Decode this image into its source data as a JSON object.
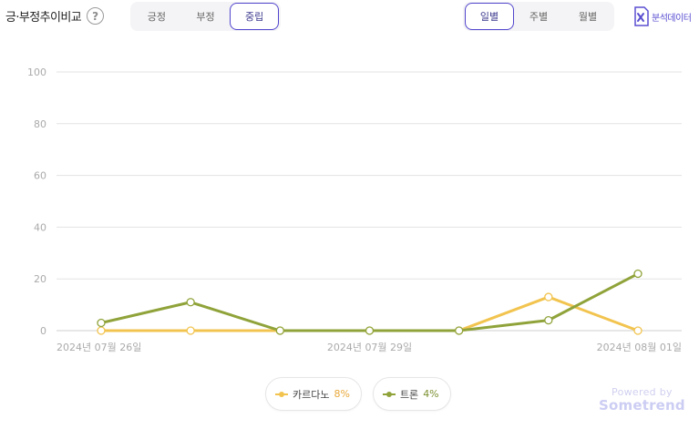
{
  "header": {
    "title": "긍·부정추이비교",
    "help_icon": "question-circle-icon",
    "sentiment_tabs": [
      {
        "label": "긍정",
        "active": false
      },
      {
        "label": "부정",
        "active": false
      },
      {
        "label": "중립",
        "active": true
      }
    ],
    "period_tabs": [
      {
        "label": "일별",
        "active": true
      },
      {
        "label": "주별",
        "active": false
      },
      {
        "label": "월별",
        "active": false
      }
    ],
    "export_label": "분석데이터",
    "export_icon": "excel-icon"
  },
  "chart_data": {
    "type": "line",
    "x": [
      "2024-07-26",
      "2024-07-27",
      "2024-07-28",
      "2024-07-29",
      "2024-07-30",
      "2024-07-31",
      "2024-08-01"
    ],
    "x_tick_labels": [
      {
        "x": "2024-07-26",
        "label": "2024년 07월 26일"
      },
      {
        "x": "2024-07-29",
        "label": "2024년 07월 29일"
      },
      {
        "x": "2024-08-01",
        "label": "2024년 08월 01일"
      }
    ],
    "y_ticks": [
      0,
      20,
      40,
      60,
      80,
      100
    ],
    "ylim": [
      0,
      100
    ],
    "grid": true,
    "series": [
      {
        "name": "카르다노",
        "percent": "8%",
        "color": "#f2c44f",
        "values": [
          0,
          0,
          0,
          0,
          0,
          13,
          0
        ]
      },
      {
        "name": "트론",
        "percent": "4%",
        "color": "#8fa33a",
        "values": [
          3,
          11,
          0,
          0,
          0,
          4,
          22
        ]
      }
    ],
    "legend_position": "bottom"
  },
  "footer": {
    "powered_by": "Powered by",
    "brand": "Sometrend"
  }
}
